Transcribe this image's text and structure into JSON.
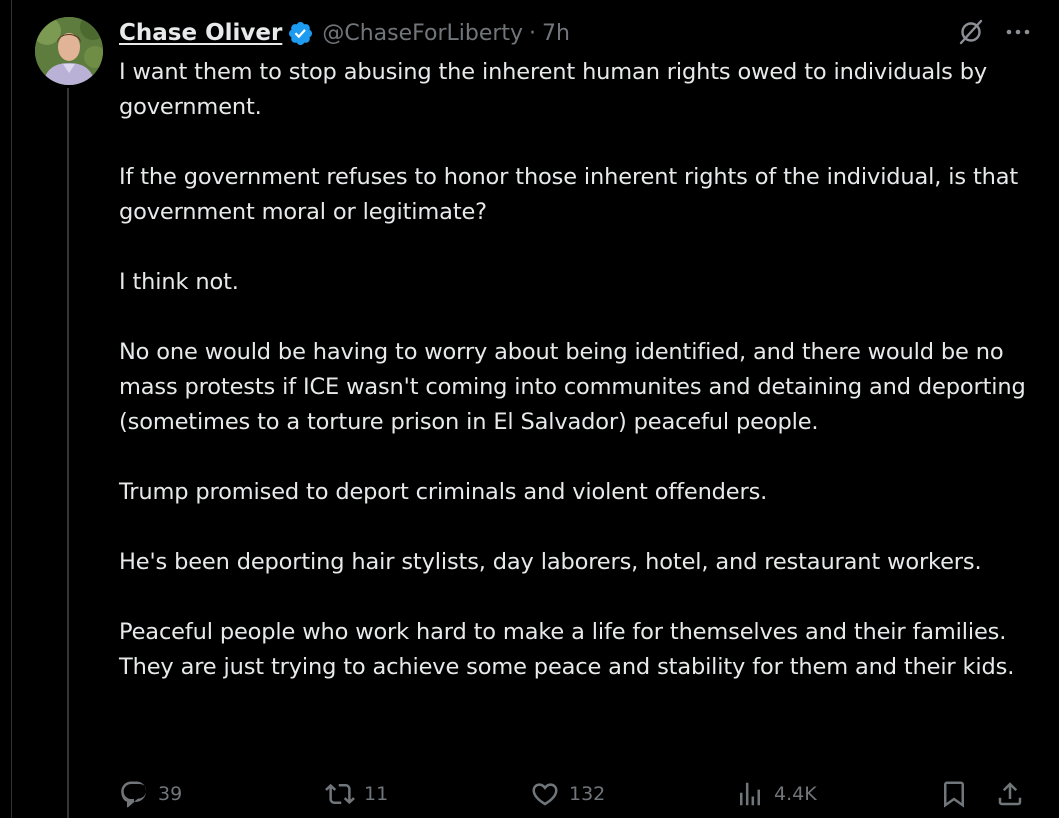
{
  "tweet": {
    "author_name": "Chase Oliver",
    "handle": "@ChaseForLiberty",
    "separator": "·",
    "time": "7h",
    "paragraphs": [
      "I want them to stop abusing the inherent human rights owed to individuals by government.",
      "If the government refuses to honor those inherent rights of the individual, is that government moral or legitimate?",
      "I think not.",
      "No one would be having to worry about being identified, and there would be no mass protests if ICE wasn't coming into communites and detaining and deporting (sometimes to a torture prison in El Salvador) peaceful people.",
      "Trump promised to deport criminals and violent offenders.",
      "He's been deporting hair stylists, day laborers, hotel, and restaurant workers.",
      "Peaceful people who work hard to make a life for themselves and their families. They are just trying to achieve some peace and stability for them and their kids."
    ]
  },
  "metrics": {
    "replies": "39",
    "reposts": "11",
    "likes": "132",
    "views": "4.4K"
  },
  "icons": {
    "verified": "verified-badge-icon",
    "grok": "grok-icon",
    "more": "more-icon",
    "reply": "reply-icon",
    "repost": "repost-icon",
    "like": "like-icon",
    "views": "views-icon",
    "bookmark": "bookmark-icon",
    "share": "share-icon"
  },
  "colors": {
    "background": "#000000",
    "text": "#e7e9ea",
    "muted": "#71767b",
    "verified_blue": "#1d9bf0"
  }
}
